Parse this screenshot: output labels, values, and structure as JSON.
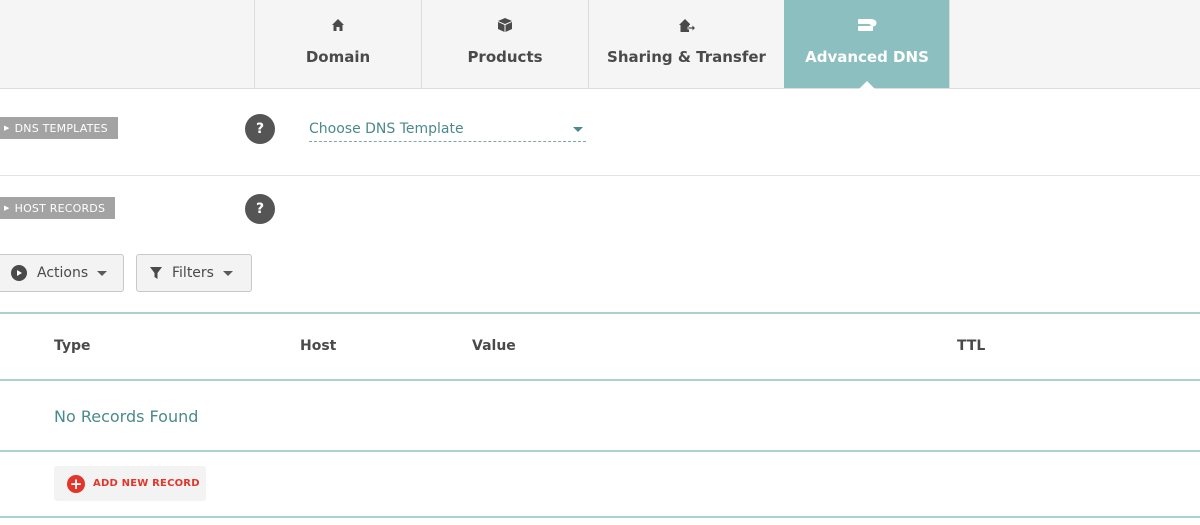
{
  "tabs": [
    {
      "label": "Domain",
      "icon": "home-icon"
    },
    {
      "label": "Products",
      "icon": "box-icon"
    },
    {
      "label": "Sharing & Transfer",
      "icon": "share-house-icon"
    },
    {
      "label": "Advanced DNS",
      "icon": "server-icon",
      "active": true
    }
  ],
  "dns_templates": {
    "section_label": "DNS TEMPLATES",
    "help": "?",
    "select_value": "Choose DNS Template"
  },
  "host_records": {
    "section_label": "HOST RECORDS",
    "help": "?",
    "actions_label": "Actions",
    "filters_label": "Filters",
    "columns": [
      "Type",
      "Host",
      "Value",
      "TTL"
    ],
    "empty_message": "No Records Found",
    "add_label": "ADD NEW RECORD"
  },
  "colors": {
    "active_tab": "#8cc0c0",
    "accent_teal": "#4b8a8a",
    "add_red": "#e2362c"
  }
}
